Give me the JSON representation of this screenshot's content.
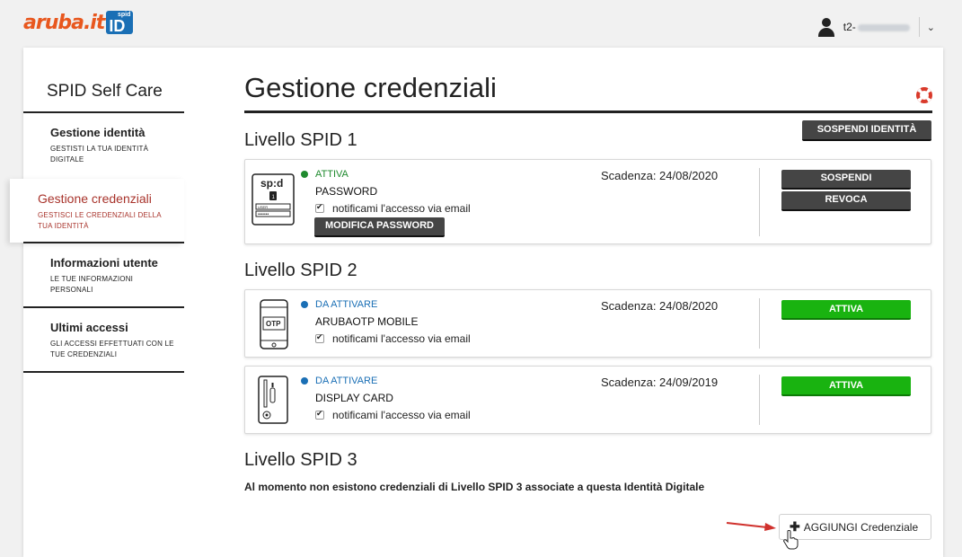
{
  "header": {
    "logo_text": "aruba.it",
    "logo_badge_small": "spid",
    "logo_badge_big": "ID",
    "user_prefix": "t2-"
  },
  "sidebar": {
    "title": "SPID Self Care",
    "items": [
      {
        "label": "Gestione identità",
        "sub": "GESTISTI LA TUA IDENTITÀ DIGITALE",
        "active": false
      },
      {
        "label": "Gestione credenziali",
        "sub": "GESTISCI LE CREDENZIALI DELLA TUA IDENTITÀ",
        "active": true
      },
      {
        "label": "Informazioni utente",
        "sub": "LE TUE INFORMAZIONI PERSONALI",
        "active": false
      },
      {
        "label": "Ultimi accessi",
        "sub": "GLI ACCESSI EFFETTUATI CON LE TUE CREDENZIALI",
        "active": false
      }
    ]
  },
  "main": {
    "title": "Gestione credenziali",
    "suspend_identity_label": "SOSPENDI IDENTITÀ",
    "levels": [
      {
        "heading": "Livello SPID 1",
        "credentials": [
          {
            "status": "ATTIVA",
            "status_color": "#1f8a2e",
            "name": "PASSWORD",
            "notify": "notificami l'accesso via email",
            "expiry": "Scadenza: 24/08/2020",
            "modify_label": "MODIFICA PASSWORD",
            "suspend_label": "SOSPENDI",
            "revoke_label": "REVOCA",
            "icon": "spid-password-icon",
            "icon_text": "sp:d"
          }
        ]
      },
      {
        "heading": "Livello SPID 2",
        "credentials": [
          {
            "status": "DA ATTIVARE",
            "status_color": "#1a6fb5",
            "name": "ARUBAOTP MOBILE",
            "notify": "notificami l'accesso via email",
            "expiry": "Scadenza: 24/08/2020",
            "activate_label": "ATTIVA",
            "icon": "otp-phone-icon",
            "icon_text": "OTP"
          },
          {
            "status": "DA ATTIVARE",
            "status_color": "#1a6fb5",
            "name": "DISPLAY CARD",
            "notify": "notificami l'accesso via email",
            "expiry": "Scadenza: 24/09/2019",
            "activate_label": "ATTIVA",
            "icon": "display-card-icon"
          }
        ]
      },
      {
        "heading": "Livello SPID 3",
        "message": "Al momento non esistono credenziali di Livello SPID 3 associate a questa Identità Digitale"
      }
    ],
    "add_button_label": "AGGIUNGI Credenziale"
  },
  "colors": {
    "accent_red": "#a8332b",
    "brand_orange": "#e8571e",
    "brand_blue": "#1a6fb5",
    "green": "#19b310"
  }
}
